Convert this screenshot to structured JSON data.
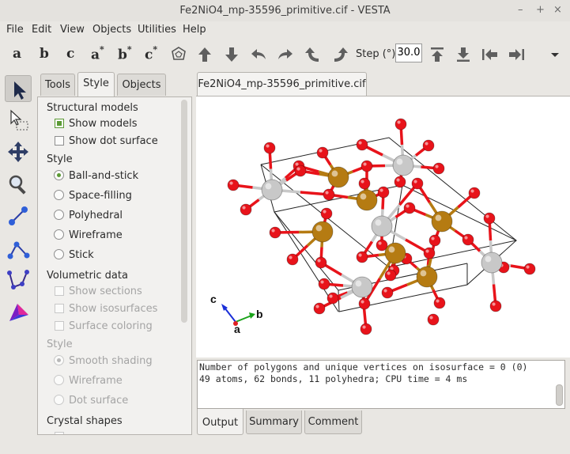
{
  "window": {
    "title": "Fe2NiO4_mp-35596_primitive.cif - VESTA",
    "controls": [
      "–",
      "+",
      "×"
    ]
  },
  "menu": [
    "File",
    "Edit",
    "View",
    "Objects",
    "Utilities",
    "Help"
  ],
  "toolbar": {
    "axes": [
      {
        "letter": "a",
        "star": ""
      },
      {
        "letter": "b",
        "star": ""
      },
      {
        "letter": "c",
        "star": ""
      },
      {
        "letter": "a",
        "star": "*"
      },
      {
        "letter": "b",
        "star": "*"
      },
      {
        "letter": "c",
        "star": "*"
      }
    ],
    "step_label": "Step (°):",
    "step_value": "30.0"
  },
  "panel_tabs": [
    "Tools",
    "Style",
    "Objects"
  ],
  "style_panel": {
    "structural_models": "Structural models",
    "show_models": "Show models",
    "show_dot_surface": "Show dot surface",
    "style_heading": "Style",
    "style_options": [
      "Ball-and-stick",
      "Space-filling",
      "Polyhedral",
      "Wireframe",
      "Stick"
    ],
    "selected_style": "Ball-and-stick",
    "volumetric_heading": "Volumetric data",
    "show_sections": "Show sections",
    "show_isosurfaces": "Show isosurfaces",
    "surface_coloring": "Surface coloring",
    "vol_style_heading": "Style",
    "vol_style_options": [
      "Smooth shading",
      "Wireframe",
      "Dot surface"
    ],
    "crystal_shapes": "Crystal shapes"
  },
  "document_tab": "Fe2NiO4_mp-35596_primitive.cif",
  "viewer": {
    "axis_labels": {
      "a": "a",
      "b": "b",
      "c": "c"
    },
    "colors": {
      "oxygen": "#e8131a",
      "iron": "#b57b12",
      "nickel": "#c8c8c8",
      "axis_a": "#e02020",
      "axis_b": "#1aa31a",
      "axis_c": "#1a2fd8"
    }
  },
  "output": {
    "lines": [
      "Number of polygons and unique vertices on isosurface = 0 (0)",
      "49 atoms, 62 bonds, 11 polyhedra; CPU time = 4 ms"
    ]
  },
  "bottom_tabs": [
    "Output",
    "Summary",
    "Comment"
  ]
}
